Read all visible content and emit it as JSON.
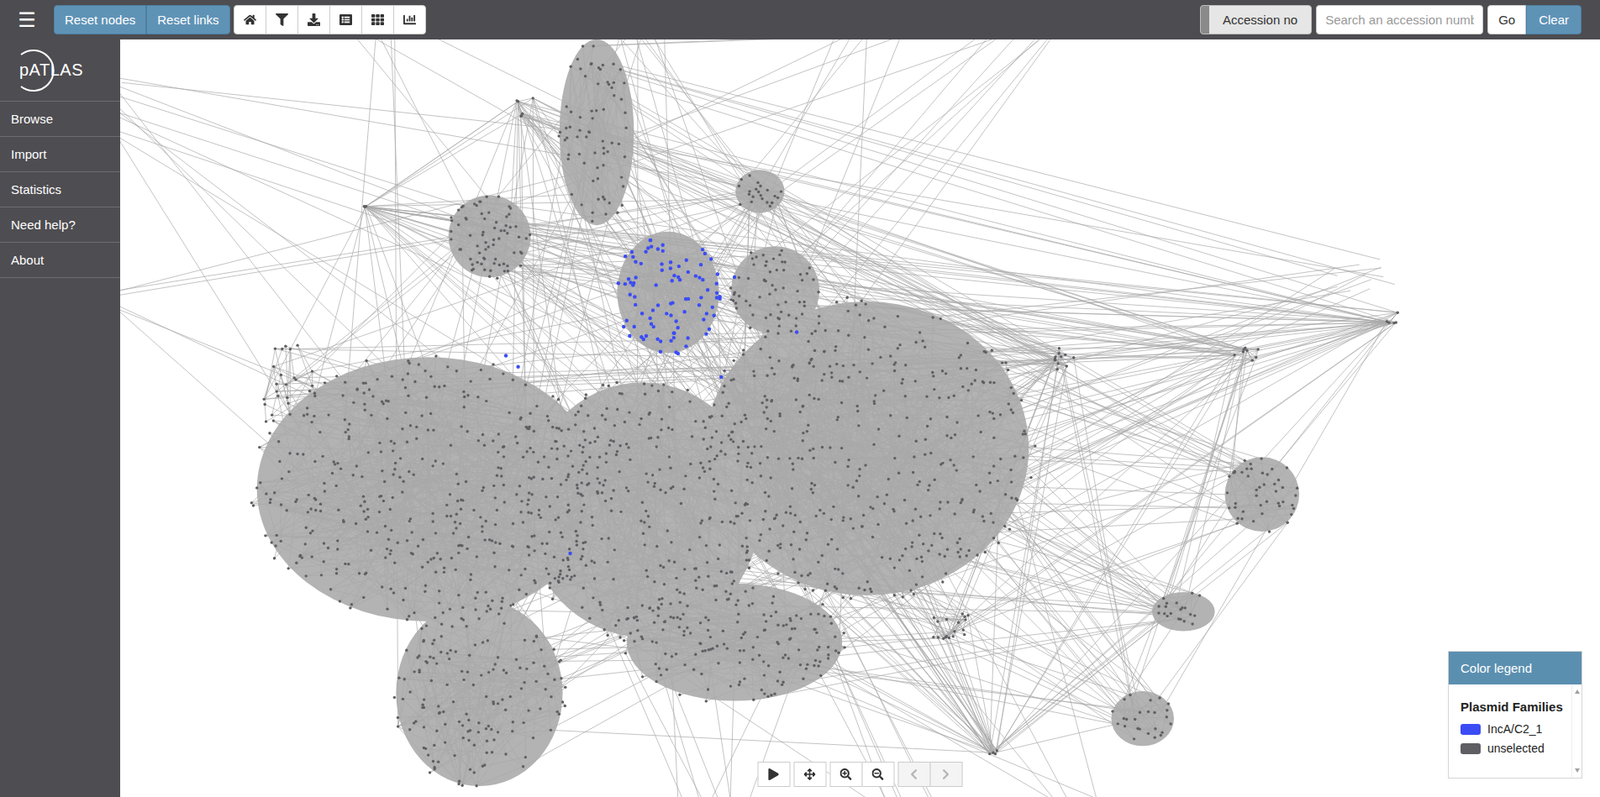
{
  "topbar": {
    "menu_icon": "☰",
    "reset_buttons": [
      "Reset nodes",
      "Reset links"
    ],
    "toggle": {
      "label": "Accession no",
      "on": false
    },
    "search": {
      "placeholder": "Search an accession numbe"
    },
    "go": "Go",
    "clear": "Clear"
  },
  "sidebar": {
    "logo": "pATLAS",
    "items": [
      "Browse",
      "Import",
      "Statistics",
      "Need help?",
      "About"
    ]
  },
  "legend": {
    "title": "Color legend",
    "section": "Plasmid Families",
    "items": [
      {
        "label": "IncA/C2_1",
        "color": "#3b4cf5"
      },
      {
        "label": "unselected",
        "color": "#5f5e63"
      }
    ]
  },
  "controls": [
    {
      "disabled": false
    },
    {
      "disabled": false
    },
    {
      "disabled": false
    },
    {
      "disabled": false
    },
    {
      "disabled": true
    },
    {
      "disabled": true
    }
  ]
}
